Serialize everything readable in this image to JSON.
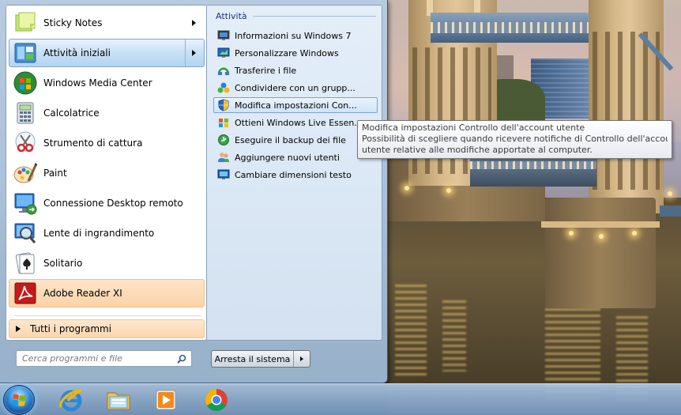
{
  "start_menu": {
    "programs": [
      {
        "label": "Sticky Notes",
        "icon": "sticky-notes-icon",
        "has_submenu": true
      },
      {
        "label": "Attività iniziali",
        "icon": "getting-started-icon",
        "has_submenu": true,
        "state": "hover"
      },
      {
        "label": "Windows Media Center",
        "icon": "windows-media-center-icon",
        "has_submenu": false
      },
      {
        "label": "Calcolatrice",
        "icon": "calculator-icon",
        "has_submenu": false
      },
      {
        "label": "Strumento di cattura",
        "icon": "snipping-tool-icon",
        "has_submenu": false
      },
      {
        "label": "Paint",
        "icon": "paint-icon",
        "has_submenu": false
      },
      {
        "label": "Connessione Desktop remoto",
        "icon": "remote-desktop-icon",
        "has_submenu": false
      },
      {
        "label": "Lente di ingrandimento",
        "icon": "magnifier-icon",
        "has_submenu": false
      },
      {
        "label": "Solitario",
        "icon": "solitaire-icon",
        "has_submenu": false
      },
      {
        "label": "Adobe Reader XI",
        "icon": "adobe-reader-icon",
        "has_submenu": false,
        "state": "newly-installed"
      }
    ],
    "all_programs_label": "Tutti i programmi",
    "search": {
      "placeholder": "Cerca programmi e file",
      "value": ""
    },
    "shutdown": {
      "label": "Arresta il sistema"
    },
    "jump_list": {
      "header": "Attività",
      "tasks": [
        {
          "label": "Informazioni su Windows 7",
          "icon": "windows-info-icon"
        },
        {
          "label": "Personalizzare Windows",
          "icon": "personalize-icon"
        },
        {
          "label": "Trasferire i file",
          "icon": "easy-transfer-icon"
        },
        {
          "label": "Condividere con un grupp...",
          "icon": "homegroup-icon"
        },
        {
          "label": "Modifica impostazioni Con...",
          "icon": "uac-shield-icon",
          "state": "hover"
        },
        {
          "label": "Ottieni Windows Live Essen...",
          "icon": "windows-flag-icon"
        },
        {
          "label": "Eseguire il backup dei file",
          "icon": "backup-icon"
        },
        {
          "label": "Aggiungere nuovi utenti",
          "icon": "users-icon"
        },
        {
          "label": "Cambiare dimensioni testo",
          "icon": "display-text-size-icon"
        }
      ]
    }
  },
  "tooltip": {
    "title": "Modifica impostazioni Controllo dell'account utente",
    "line1": "Possibilità di scegliere quando ricevere notifiche di Controllo dell'account",
    "line2": "utente relative alle modifiche apportate al computer."
  },
  "taskbar": {
    "items": [
      {
        "icon": "internet-explorer-icon"
      },
      {
        "icon": "windows-explorer-icon"
      },
      {
        "icon": "media-player-icon"
      },
      {
        "icon": "chrome-icon"
      }
    ]
  },
  "colors": {
    "hover_blue": "#c7e0f6",
    "new_program_orange": "#fbd3a8",
    "jump_list_header": "#1e3287"
  }
}
